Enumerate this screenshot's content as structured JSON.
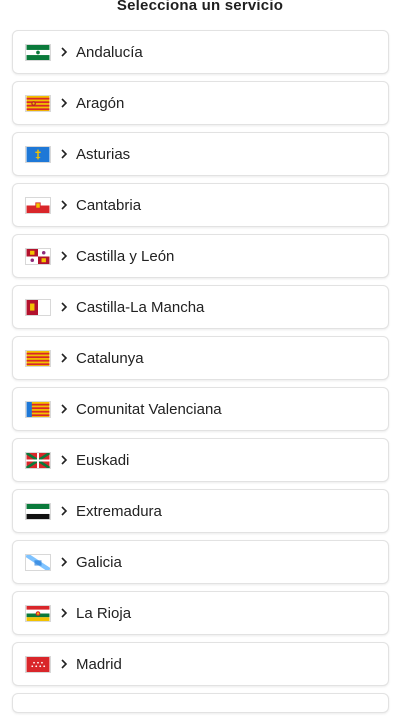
{
  "header": {
    "title": "Selecciona un servicio"
  },
  "items": [
    {
      "label": "Andalucía",
      "flag": "andalucia"
    },
    {
      "label": "Aragón",
      "flag": "aragon"
    },
    {
      "label": "Asturias",
      "flag": "asturias"
    },
    {
      "label": "Cantabria",
      "flag": "cantabria"
    },
    {
      "label": "Castilla y León",
      "flag": "castilla-leon"
    },
    {
      "label": "Castilla-La Mancha",
      "flag": "castilla-la-mancha"
    },
    {
      "label": "Catalunya",
      "flag": "catalunya"
    },
    {
      "label": "Comunitat Valenciana",
      "flag": "valenciana"
    },
    {
      "label": "Euskadi",
      "flag": "euskadi"
    },
    {
      "label": "Extremadura",
      "flag": "extremadura"
    },
    {
      "label": "Galicia",
      "flag": "galicia"
    },
    {
      "label": "La Rioja",
      "flag": "la-rioja"
    },
    {
      "label": "Madrid",
      "flag": "madrid"
    }
  ],
  "colors": {
    "green": "#0a7a3b",
    "red": "#d9262a",
    "yellow": "#f2c200",
    "blue": "#1e78d7",
    "light_blue": "#7fc3ff"
  }
}
